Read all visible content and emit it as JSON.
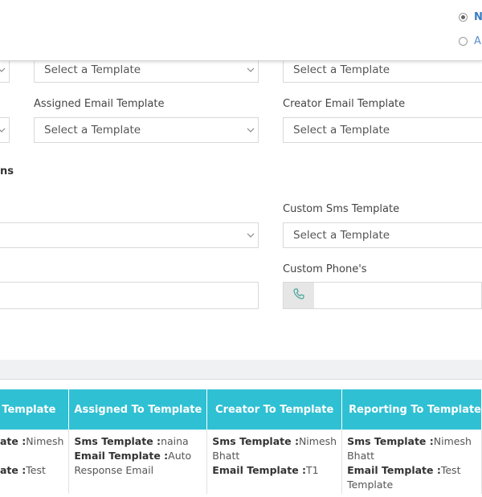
{
  "notify_options": [
    {
      "label": "N",
      "checked": true
    },
    {
      "label": "A",
      "checked": false
    }
  ],
  "row1": {
    "left_select": "",
    "mid_select": "Select a Template",
    "right_select": "Select a Template"
  },
  "row2": {
    "mid_label": "Assigned Email Template",
    "mid_select": "Select a Template",
    "right_label": "Creator Email Template",
    "right_select": "Select a Template"
  },
  "section": {
    "title": "ns"
  },
  "custom": {
    "sms_label": "Custom Sms Template",
    "sms_select": "Select a Template",
    "phone_label": "Custom Phone's",
    "phone_value": ""
  },
  "table": {
    "headers": [
      "Template",
      "Assigned To Template",
      "Creator To Template",
      "Reporting To Template"
    ],
    "rows": [
      {
        "c0": {
          "sms_label": "ate :",
          "sms_value": "Nimesh",
          "email_label": "ate :",
          "email_value": "Test"
        },
        "c1": {
          "sms_label": "Sms Template :",
          "sms_value": "naina",
          "email_label": "Email Template :",
          "email_value": "Auto",
          "email_cont": "Response Email"
        },
        "c2": {
          "sms_label": "Sms Template :",
          "sms_value": "Nimesh",
          "sms_cont": "Bhatt",
          "email_label": "Email Template :",
          "email_value": "T1"
        },
        "c3": {
          "sms_label": "Sms Template :",
          "sms_value": "Nimesh",
          "sms_cont": "Bhatt",
          "email_label": "Email Template :",
          "email_value": "Test",
          "email_cont": "Template"
        }
      }
    ]
  }
}
